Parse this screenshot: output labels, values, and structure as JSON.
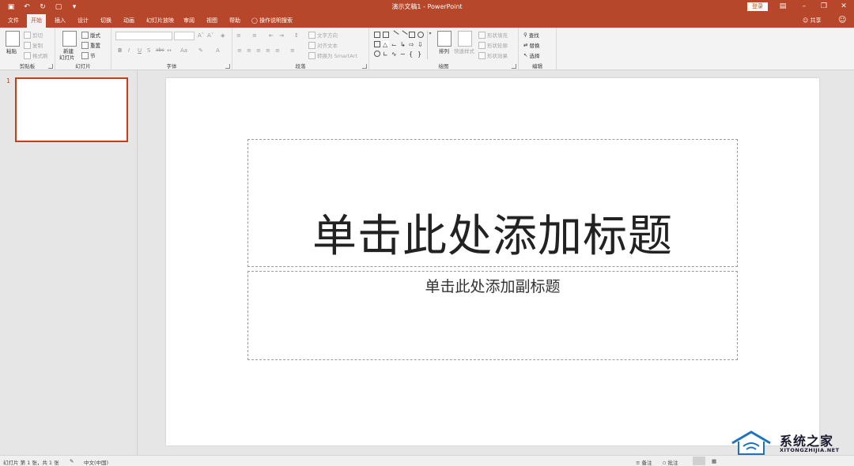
{
  "app": {
    "doc_title": "演示文稿1  -  PowerPoint",
    "login_label": "登录",
    "share_label": "共享"
  },
  "tabs": [
    {
      "label": "文件"
    },
    {
      "label": "开始"
    },
    {
      "label": "插入"
    },
    {
      "label": "设计"
    },
    {
      "label": "切换"
    },
    {
      "label": "动画"
    },
    {
      "label": "幻灯片放映"
    },
    {
      "label": "审阅"
    },
    {
      "label": "视图"
    },
    {
      "label": "帮助"
    }
  ],
  "tell_me": "操作说明搜索",
  "ribbon": {
    "clipboard": {
      "label": "剪贴板",
      "paste": "粘贴",
      "cut": "剪切",
      "copy": "复制",
      "format_painter": "格式刷"
    },
    "slides": {
      "label": "幻灯片",
      "new_slide_line1": "新建",
      "new_slide_line2": "幻灯片",
      "layout": "版式",
      "reset": "重置",
      "section": "节"
    },
    "font": {
      "label": "字体"
    },
    "paragraph": {
      "label": "段落",
      "text_direction": "文字方向",
      "align_text": "对齐文本",
      "convert_smartart": "转换为 SmartArt"
    },
    "drawing": {
      "label": "绘图",
      "arrange": "排列",
      "quick_styles": "快速样式",
      "shape_fill": "形状填充",
      "shape_outline": "形状轮廓",
      "shape_effects": "形状效果"
    },
    "editing": {
      "label": "编辑",
      "find": "查找",
      "replace": "替换",
      "select": "选择"
    }
  },
  "thumbnails": [
    {
      "number": "1"
    }
  ],
  "slide": {
    "title_placeholder": "单击此处添加标题",
    "subtitle_placeholder": "单击此处添加副标题"
  },
  "statusbar": {
    "slide_info": "幻灯片 第 1 张，共 1 张",
    "language": "中文(中国)",
    "notes": "备注",
    "comments": "批注"
  },
  "watermark": {
    "text": "系统之家",
    "sub": "XITONGZHIJIA.NET"
  },
  "colors": {
    "accent": "#b7472a",
    "selection": "#c43e1c"
  }
}
